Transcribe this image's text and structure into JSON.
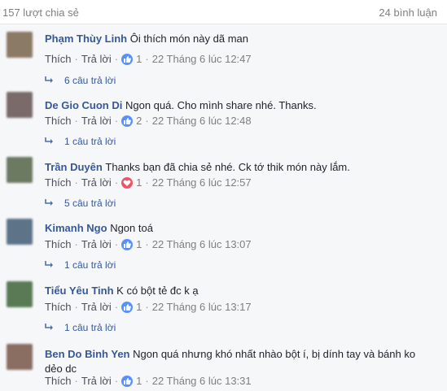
{
  "header": {
    "shares": "157 lượt chia sẻ",
    "comment_count": "24 bình luận"
  },
  "labels": {
    "like": "Thích",
    "reply": "Trả lời"
  },
  "comments": [
    {
      "author": "Phạm Thùy Linh",
      "text": "Ôi thích món này dã man",
      "reaction": "like-icon",
      "reaction_count": "1",
      "time": "22 Tháng 6 lúc 12:47",
      "replies": "6 câu trả lời",
      "avatar_color": "#8a7a66"
    },
    {
      "author": "De Gio Cuon Di",
      "text": "Ngon quá. Cho mình share nhé. Thanks.",
      "reaction": "like-icon",
      "reaction_count": "2",
      "time": "22 Tháng 6 lúc 12:48",
      "replies": "1 câu trả lời",
      "avatar_color": "#7a6a6a"
    },
    {
      "author": "Trần Duyên",
      "text": "Thanks bạn đã chia sẻ nhé. Ck tớ thik món này lắm.",
      "reaction": "love-icon",
      "reaction_count": "1",
      "time": "22 Tháng 6 lúc 12:57",
      "replies": "5 câu trả lời",
      "avatar_color": "#6d7a62"
    },
    {
      "author": "Kimanh Ngo",
      "text": "Ngon toá",
      "reaction": "like-icon",
      "reaction_count": "1",
      "time": "22 Tháng 6 lúc 13:07",
      "replies": "1 câu trả lời",
      "avatar_color": "#5d7488"
    },
    {
      "author": "Tiểu Yêu Tinh",
      "text": "K có bột tẻ đc k ạ",
      "reaction": "like-icon",
      "reaction_count": "1",
      "time": "22 Tháng 6 lúc 13:17",
      "replies": "1 câu trả lời",
      "avatar_color": "#5a7a56"
    },
    {
      "author": "Ben Do Binh Yen",
      "text": "Ngon quá nhưng khó nhất nhào bột í, bị dính tay và bánh ko dẻo dc",
      "reaction": "like-icon",
      "reaction_count": "1",
      "time": "22 Tháng 6 lúc 13:31",
      "replies": "",
      "avatar_color": "#8a6e62"
    }
  ]
}
